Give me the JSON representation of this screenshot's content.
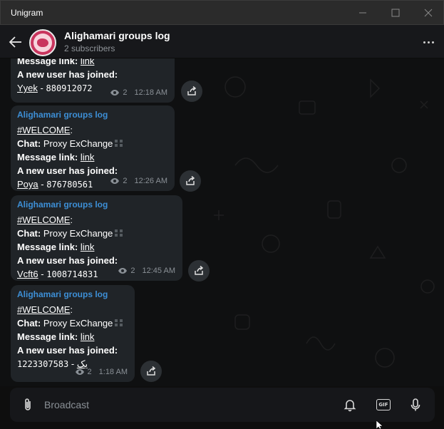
{
  "window": {
    "title": "Unigram"
  },
  "header": {
    "title": "Alighamari groups log",
    "subtitle": "2 subscribers"
  },
  "messages": [
    {
      "partial": true,
      "sender": "",
      "link_label": "Message link:",
      "link_text": "link",
      "joined_label": "A new user has joined:",
      "user_name": "Yyek",
      "separator": "-",
      "user_id": "880912072",
      "views": "2",
      "time": "12:18 AM"
    },
    {
      "sender": "Alighamari groups log",
      "hashtag": "#WELCOME",
      "colon": ":",
      "chat_label": "Chat:",
      "chat_name": "Proxy ExChange",
      "link_label": "Message link:",
      "link_text": "link",
      "joined_label": "A new user has joined:",
      "user_name": "Poya",
      "separator": "-",
      "user_id": "876780561",
      "views": "2",
      "time": "12:26 AM"
    },
    {
      "sender": "Alighamari groups log",
      "hashtag": "#WELCOME",
      "colon": ":",
      "chat_label": "Chat:",
      "chat_name": "Proxy ExChange",
      "link_label": "Message link:",
      "link_text": "link",
      "joined_label": "A new user has joined:",
      "user_name": "Vcft6",
      "separator": "-",
      "user_id": "1008714831",
      "views": "2",
      "time": "12:45 AM"
    },
    {
      "sender": "Alighamari groups log",
      "hashtag": "#WELCOME",
      "colon": ":",
      "chat_label": "Chat:",
      "chat_name": "Proxy ExChange",
      "link_label": "Message link:",
      "link_text": "link",
      "joined_label": "A new user has joined:",
      "user_name": "یک",
      "separator": "-",
      "user_id": "1223307583",
      "views": "2",
      "time": "1:18 AM"
    }
  ],
  "composer": {
    "placeholder": "Broadcast",
    "gif_label": "GIF"
  },
  "icons": {
    "back": "arrow-left-icon",
    "more": "more-dots-icon",
    "share": "share-icon",
    "views": "eye-icon",
    "attach": "paperclip-icon",
    "bell": "bell-icon",
    "gif": "gif-icon",
    "mic": "microphone-icon"
  },
  "colors": {
    "sender": "#3d8fd6",
    "bubble": "#202428",
    "avatar": "#c9355e"
  }
}
